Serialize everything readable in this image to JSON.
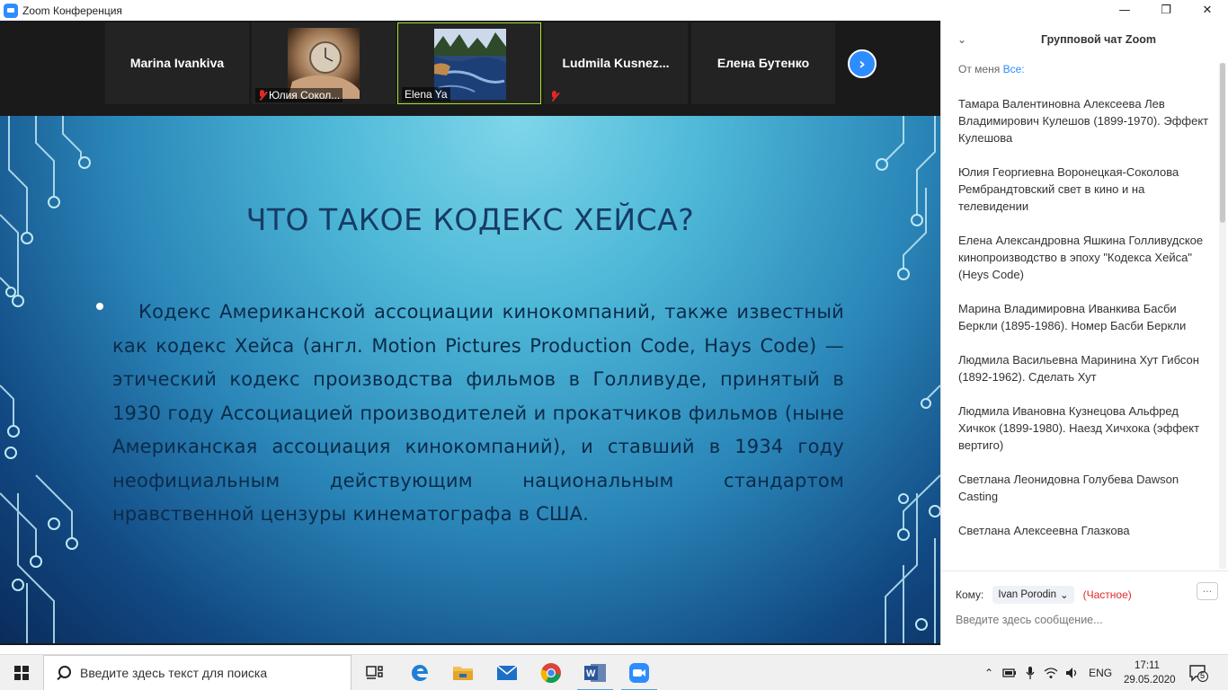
{
  "window": {
    "title": "Zoom Конференция",
    "minimize": "—",
    "maximize": "❐",
    "close": "✕"
  },
  "participants": [
    {
      "name": "Marina Ivankiva",
      "type": "name"
    },
    {
      "name": "Юлия Сокол...",
      "type": "photo",
      "muted": true
    },
    {
      "name": "Elena Ya",
      "type": "photo",
      "muted": false,
      "active": true
    },
    {
      "name": "Ludmila  Kusnez...",
      "type": "name",
      "muted": true
    },
    {
      "name": "Елена Бутенко",
      "type": "name"
    }
  ],
  "slide": {
    "title": "ЧТО ТАКОЕ КОДЕКС ХЕЙСА?",
    "body": "Кодекс Американской ассоциации кинокомпаний, также известный как кодекс Хейса (англ. Motion Pictures Production Code, Hays Code) — этический кодекс производства фильмов в Голливуде, принятый в 1930 году Ассоциацией производителей и прокатчиков фильмов (ныне Американская ассоциация кинокомпаний), и ставший в 1934 году неофициальным действующим национальным стандартом нравственной цензуры кинематографа в США."
  },
  "chat": {
    "title": "Групповой чат Zoom",
    "from_label": "От меня",
    "from_target": "Все:",
    "messages": [
      "Тамара Валентиновна Алексеева Лев Владимирович Кулешов (1899-1970). Эффект Кулешова",
      "Юлия Георгиевна Воронецкая-Соколова Рембрандтовский свет в кино и на телевидении",
      "Елена Александровна Яшкина Голливудское кинопроизводство в эпоху \"Кодекса Хейса\" (Heys  Code)",
      "Марина Владимировна Иванкива Басби Беркли (1895-1986). Номер Басби Беркли",
      "Людмила Васильевна Маринина Хут Гибсон (1892-1962). Сделать Хут",
      "Людмила Ивановна Кузнецова Альфред Хичкок (1899-1980). Наезд Хичхока (эффект вертиго)",
      "Светлана Леонидовна Голубева Dawson Casting",
      "Светлана Алексеевна Глазкова"
    ],
    "to_label": "Кому:",
    "recipient": "Ivan Porodin",
    "private_label": "(Частное)",
    "more": "···",
    "input_placeholder": "Введите здесь сообщение..."
  },
  "taskbar": {
    "search_placeholder": "Введите здесь текст для поиска",
    "language": "ENG",
    "time": "17:11",
    "date": "29.05.2020",
    "notifications": "5"
  },
  "colors": {
    "zoom_blue": "#2d8cff",
    "muted_red": "#e02828",
    "active_speaker": "#a6e22e",
    "slide_text": "#0b2b4a",
    "slide_title": "#163c66"
  }
}
